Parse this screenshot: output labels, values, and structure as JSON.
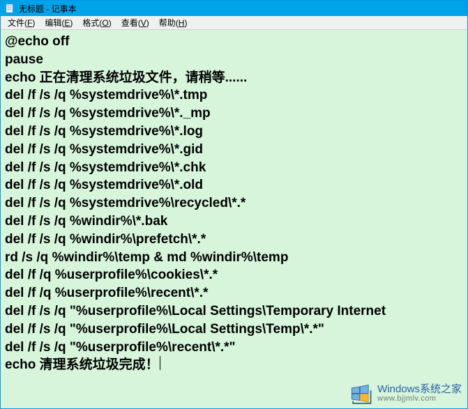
{
  "titlebar": {
    "icon_name": "notepad-icon",
    "title": "无标题 - 记事本"
  },
  "menubar": {
    "items": [
      {
        "label": "文件",
        "accel": "F"
      },
      {
        "label": "编辑",
        "accel": "E"
      },
      {
        "label": "格式",
        "accel": "O"
      },
      {
        "label": "查看",
        "accel": "V"
      },
      {
        "label": "帮助",
        "accel": "H"
      }
    ]
  },
  "editor": {
    "lines": [
      "@echo off",
      "pause",
      "echo 正在清理系统垃圾文件，请稍等......",
      "del /f /s /q %systemdrive%\\*.tmp",
      "del /f /s /q %systemdrive%\\*._mp",
      "del /f /s /q %systemdrive%\\*.log",
      "del /f /s /q %systemdrive%\\*.gid",
      "del /f /s /q %systemdrive%\\*.chk",
      "del /f /s /q %systemdrive%\\*.old",
      "del /f /s /q %systemdrive%\\recycled\\*.*",
      "del /f /s /q %windir%\\*.bak",
      "del /f /s /q %windir%\\prefetch\\*.*",
      "rd /s /q %windir%\\temp & md %windir%\\temp",
      "del /f /q %userprofile%\\cookies\\*.*",
      "del /f /q %userprofile%\\recent\\*.*",
      "del /f /s /q \"%userprofile%\\Local Settings\\Temporary Internet",
      "del /f /s /q \"%userprofile%\\Local Settings\\Temp\\*.*\"",
      "del /f /s /q \"%userprofile%\\recent\\*.*\"",
      "echo 清理系统垃圾完成！"
    ]
  },
  "watermark": {
    "text_main": "Windows系统之家",
    "text_sub": "www.bjjmlv.com"
  }
}
